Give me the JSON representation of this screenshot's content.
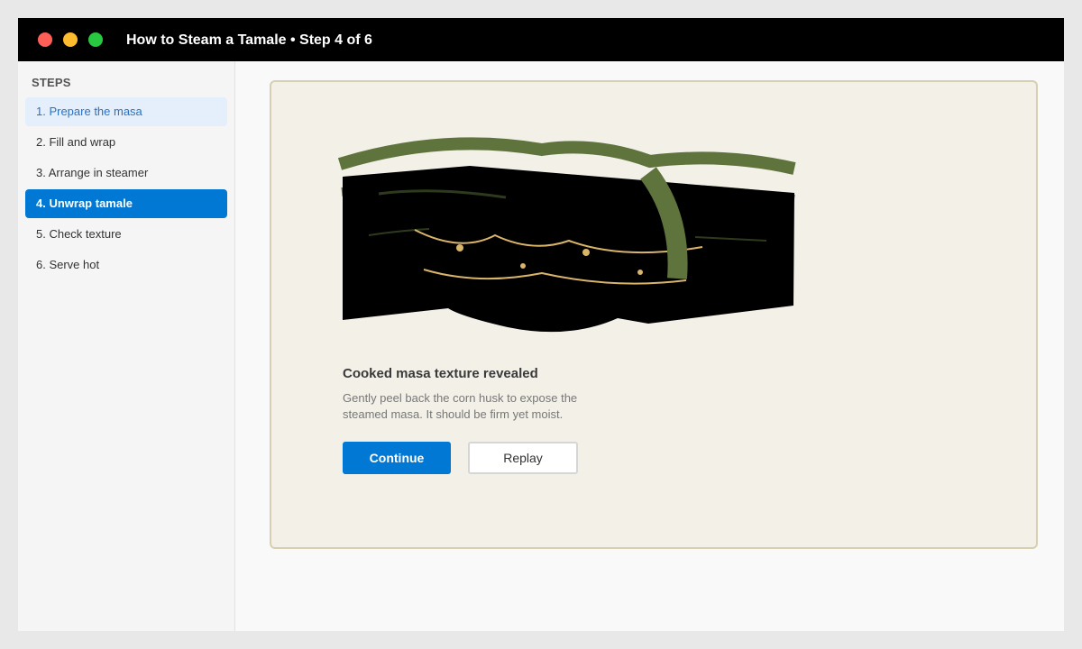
{
  "window": {
    "title": "How to Steam a Tamale • Step 4 of 6"
  },
  "sidebar": {
    "header": "STEPS",
    "steps": [
      {
        "label": "1. Prepare the masa",
        "state": "done"
      },
      {
        "label": "2. Fill and wrap",
        "state": "pending"
      },
      {
        "label": "3. Arrange in steamer",
        "state": "pending"
      },
      {
        "label": "4. Unwrap tamale",
        "state": "active"
      },
      {
        "label": "5. Check texture",
        "state": "pending"
      },
      {
        "label": "6. Serve hot",
        "state": "pending"
      }
    ]
  },
  "main": {
    "illustration": "steamed-tamale-unwrapped",
    "caption_title": "Cooked masa texture revealed",
    "caption_text": "Gently peel back the corn husk to expose the steamed masa. It should be firm yet moist.",
    "continue_label": "Continue",
    "replay_label": "Replay"
  },
  "colors": {
    "accent": "#0078d4",
    "husk": "#5f733d",
    "masa_line": "#d9b56a",
    "card_bg": "#f3f0e8",
    "card_border": "#d6cfb2"
  }
}
